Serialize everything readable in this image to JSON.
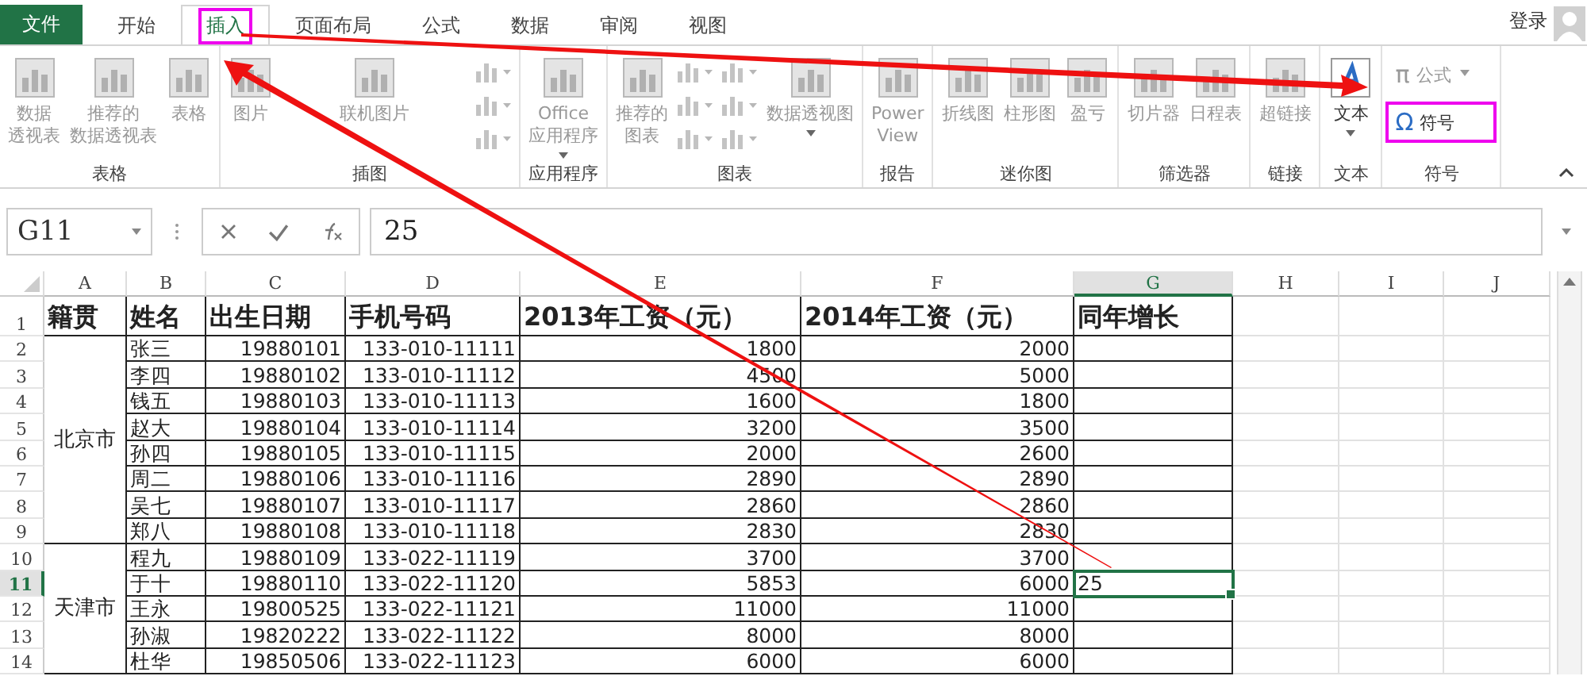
{
  "file_tab": "文件",
  "tabs": [
    {
      "label": "开始",
      "selected": false,
      "highlighted": false
    },
    {
      "label": "插入",
      "selected": true,
      "highlighted": true
    },
    {
      "label": "页面布局",
      "selected": false,
      "highlighted": false
    },
    {
      "label": "公式",
      "selected": false,
      "highlighted": false
    },
    {
      "label": "数据",
      "selected": false,
      "highlighted": false
    },
    {
      "label": "审阅",
      "selected": false,
      "highlighted": false
    },
    {
      "label": "视图",
      "selected": false,
      "highlighted": false
    }
  ],
  "sign_in": "登录",
  "ribbon_groups": [
    {
      "label": "表格",
      "items": [
        {
          "kind": "large",
          "lines": [
            "数据",
            "透视表"
          ],
          "disabled": true,
          "dropdown": false,
          "highlighted": false
        },
        {
          "kind": "large",
          "lines": [
            "推荐的",
            "数据透视表"
          ],
          "disabled": true,
          "dropdown": false,
          "highlighted": false
        },
        {
          "kind": "large",
          "lines": [
            "表格"
          ],
          "disabled": true,
          "dropdown": false,
          "highlighted": false
        }
      ]
    },
    {
      "label": "插图",
      "items": [
        {
          "kind": "large",
          "lines": [
            "图片"
          ],
          "disabled": true,
          "dropdown": false,
          "highlighted": false
        },
        {
          "kind": "large",
          "lines": [
            "联机图片"
          ],
          "disabled": true,
          "dropdown": false,
          "highlighted": false
        },
        {
          "kind": "icon-column",
          "disabled": true
        }
      ]
    },
    {
      "label": "应用程序",
      "items": [
        {
          "kind": "large",
          "lines": [
            "Office",
            "应用程序"
          ],
          "disabled": true,
          "dropdown": true,
          "highlighted": false
        }
      ]
    },
    {
      "label": "图表",
      "items": [
        {
          "kind": "large",
          "lines": [
            "推荐的",
            "图表"
          ],
          "disabled": true,
          "dropdown": false,
          "highlighted": false
        },
        {
          "kind": "icon-column",
          "disabled": true
        },
        {
          "kind": "icon-column",
          "disabled": true
        },
        {
          "kind": "large",
          "lines": [
            "数据透视图"
          ],
          "disabled": true,
          "dropdown": true,
          "highlighted": false
        }
      ]
    },
    {
      "label": "报告",
      "items": [
        {
          "kind": "large",
          "lines": [
            "Power",
            "View"
          ],
          "disabled": true,
          "dropdown": false,
          "highlighted": false
        }
      ]
    },
    {
      "label": "迷你图",
      "items": [
        {
          "kind": "large",
          "lines": [
            "折线图"
          ],
          "disabled": true,
          "dropdown": false,
          "highlighted": false
        },
        {
          "kind": "large",
          "lines": [
            "柱形图"
          ],
          "disabled": true,
          "dropdown": false,
          "highlighted": false
        },
        {
          "kind": "large",
          "lines": [
            "盈亏"
          ],
          "disabled": true,
          "dropdown": false,
          "highlighted": false
        }
      ]
    },
    {
      "label": "筛选器",
      "items": [
        {
          "kind": "large",
          "lines": [
            "切片器"
          ],
          "disabled": true,
          "dropdown": false,
          "highlighted": false
        },
        {
          "kind": "large",
          "lines": [
            "日程表"
          ],
          "disabled": true,
          "dropdown": false,
          "highlighted": false
        }
      ]
    },
    {
      "label": "链接",
      "items": [
        {
          "kind": "large",
          "lines": [
            "超链接"
          ],
          "disabled": true,
          "dropdown": false,
          "highlighted": false
        }
      ]
    },
    {
      "label": "文本",
      "items": [
        {
          "kind": "large",
          "lines": [
            "文本"
          ],
          "disabled": false,
          "dropdown": true,
          "highlighted": false
        }
      ]
    },
    {
      "label": "符号",
      "items": [
        {
          "kind": "small",
          "glyph": "π",
          "label": "公式",
          "disabled": true,
          "dropdown": true,
          "highlighted": false
        },
        {
          "kind": "small",
          "glyph": "Ω",
          "label": "符号",
          "disabled": false,
          "dropdown": false,
          "highlighted": true
        }
      ]
    }
  ],
  "name_box": "G11",
  "formula": "25",
  "columns": [
    {
      "label": "A",
      "selected": false
    },
    {
      "label": "B",
      "selected": false
    },
    {
      "label": "C",
      "selected": false
    },
    {
      "label": "D",
      "selected": false
    },
    {
      "label": "E",
      "selected": false
    },
    {
      "label": "F",
      "selected": false
    },
    {
      "label": "G",
      "selected": true
    },
    {
      "label": "H",
      "selected": false
    },
    {
      "label": "I",
      "selected": false
    },
    {
      "label": "J",
      "selected": false
    }
  ],
  "header_row": {
    "number": "1",
    "cells": [
      "籍贯",
      "姓名",
      "出生日期",
      "手机号码",
      "2013年工资（元）",
      "2014年工资（元）",
      "同年增长"
    ]
  },
  "rows": [
    {
      "number": "2",
      "selected": false,
      "region": "北京市",
      "cells": [
        "张三",
        "19880101",
        "133-010-11111",
        "1800",
        "2000"
      ]
    },
    {
      "number": "3",
      "selected": false,
      "cells": [
        "李四",
        "19880102",
        "133-010-11112",
        "4500",
        "5000"
      ]
    },
    {
      "number": "4",
      "selected": false,
      "cells": [
        "钱五",
        "19880103",
        "133-010-11113",
        "1600",
        "1800"
      ]
    },
    {
      "number": "5",
      "selected": false,
      "cells": [
        "赵大",
        "19880104",
        "133-010-11114",
        "3200",
        "3500"
      ]
    },
    {
      "number": "6",
      "selected": false,
      "cells": [
        "孙四",
        "19880105",
        "133-010-11115",
        "2000",
        "2600"
      ]
    },
    {
      "number": "7",
      "selected": false,
      "cells": [
        "周二",
        "19880106",
        "133-010-11116",
        "2890",
        "2890"
      ]
    },
    {
      "number": "8",
      "selected": false,
      "cells": [
        "吴七",
        "19880107",
        "133-010-11117",
        "2860",
        "2860"
      ]
    },
    {
      "number": "9",
      "selected": false,
      "cells": [
        "郑八",
        "19880108",
        "133-010-11118",
        "2830",
        "2830"
      ]
    },
    {
      "number": "10",
      "selected": false,
      "region": "天津市",
      "cells": [
        "程九",
        "19880109",
        "133-022-11119",
        "3700",
        "3700"
      ]
    },
    {
      "number": "11",
      "selected": true,
      "cells": [
        "于十",
        "19880110",
        "133-022-11120",
        "5853",
        "6000"
      ],
      "growth": "25"
    },
    {
      "number": "12",
      "selected": false,
      "cells": [
        "王永",
        "19800525",
        "133-022-11121",
        "11000",
        "11000"
      ]
    },
    {
      "number": "13",
      "selected": false,
      "cells": [
        "孙淑",
        "19820222",
        "133-022-11122",
        "8000",
        "8000"
      ]
    },
    {
      "number": "14",
      "selected": false,
      "cells": [
        "杜华",
        "19850506",
        "133-022-11123",
        "6000",
        "6000"
      ]
    }
  ]
}
